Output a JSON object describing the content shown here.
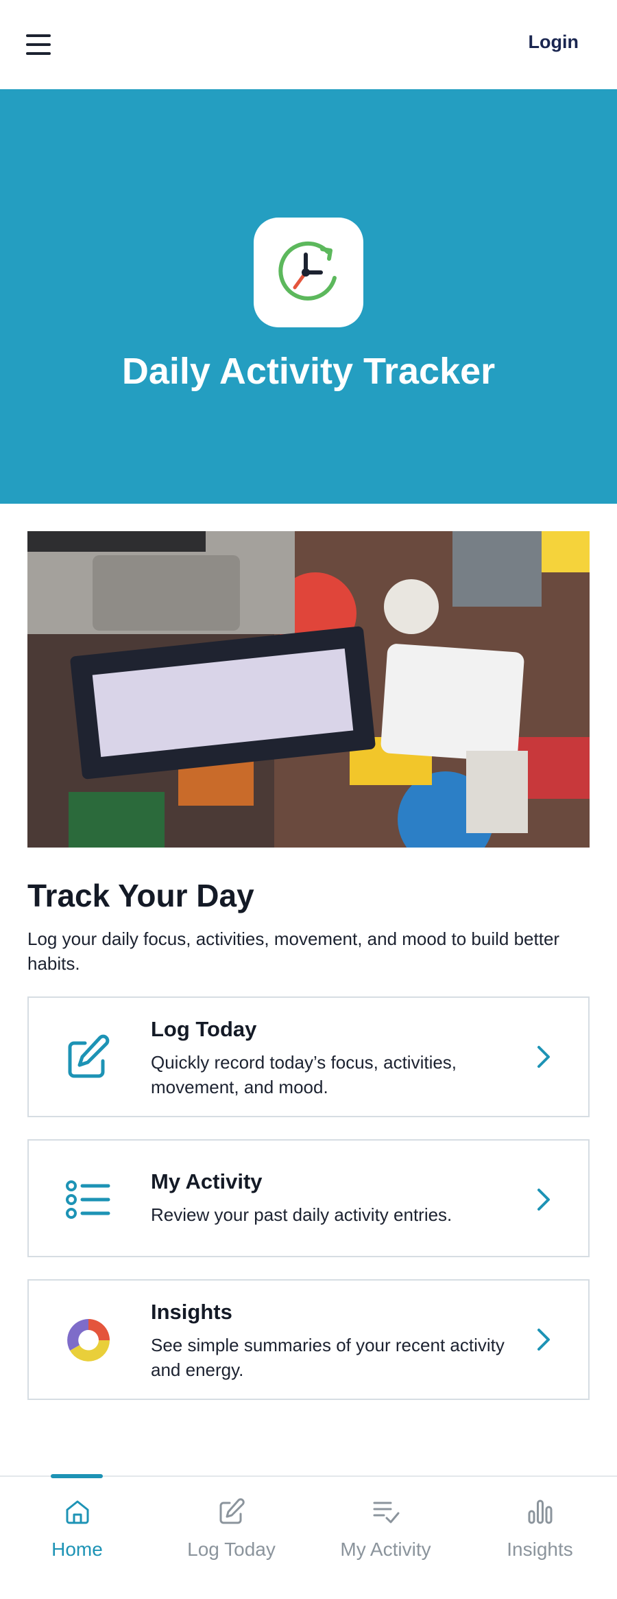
{
  "header": {
    "menu_icon": "hamburger-icon",
    "login_label": "Login"
  },
  "hero": {
    "title": "Daily Activity Tracker",
    "icon": "clock-refresh-icon",
    "background": "#249ec1"
  },
  "main": {
    "title": "Track Your Day",
    "description": "Log your daily focus, activities, movement, and mood to build better habits.",
    "cards": [
      {
        "title": "Log Today",
        "description": "Quickly record today’s focus, activities, movement, and mood.",
        "icon": "edit-icon"
      },
      {
        "title": "My Activity",
        "description": "Review your past daily activity entries.",
        "icon": "list-icon"
      },
      {
        "title": "Insights",
        "description": "See simple summaries of your recent activity and energy.",
        "icon": "pie-chart-icon"
      }
    ]
  },
  "nav": {
    "items": [
      {
        "label": "Home",
        "icon": "home-icon",
        "active": true
      },
      {
        "label": "Log Today",
        "icon": "edit-icon",
        "active": false
      },
      {
        "label": "My Activity",
        "icon": "list-check-icon",
        "active": false
      },
      {
        "label": "Insights",
        "icon": "bar-chart-icon",
        "active": false
      }
    ]
  },
  "colors": {
    "accent": "#1d93b5",
    "hero": "#249ec1",
    "inactive": "#8b949c"
  }
}
